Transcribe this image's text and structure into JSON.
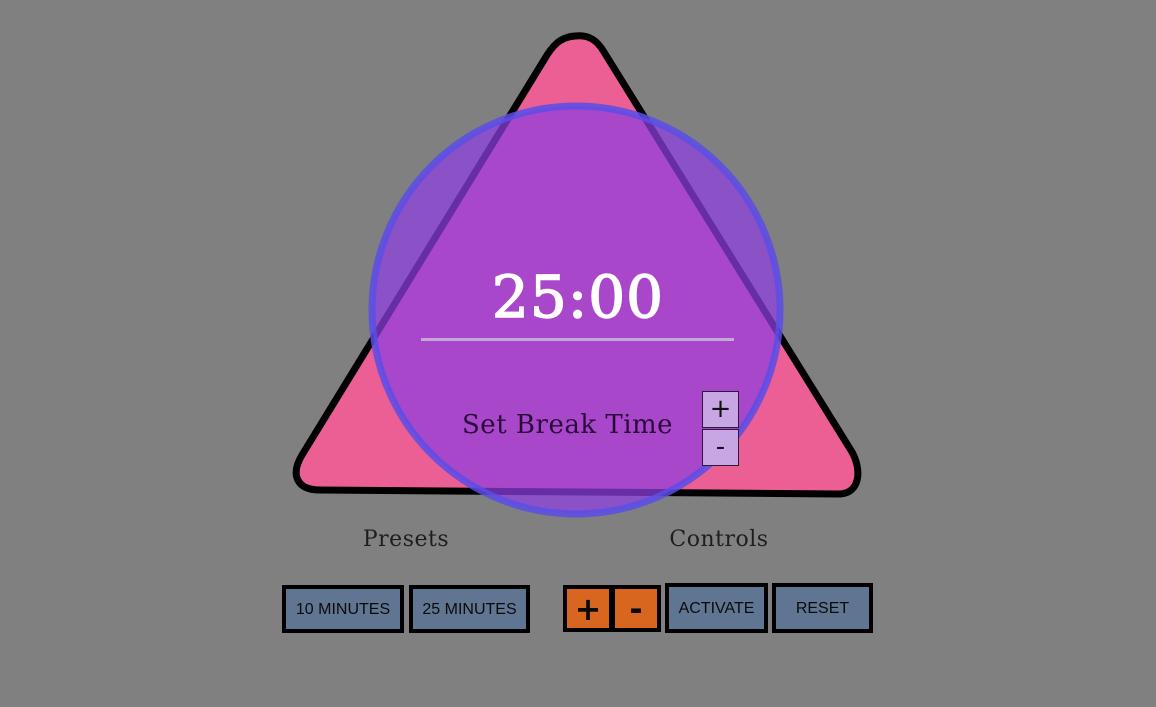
{
  "timer": {
    "display": "25:00"
  },
  "break_time": {
    "label": "Set Break Time",
    "plus_label": "+",
    "minus_label": "-"
  },
  "presets": {
    "title": "Presets",
    "buttons": [
      {
        "label": "10 MINUTES"
      },
      {
        "label": "25 MINUTES"
      }
    ]
  },
  "controls": {
    "title": "Controls",
    "plus_label": "+",
    "minus_label": "-",
    "activate_label": "ACTIVATE",
    "reset_label": "RESET"
  },
  "colors": {
    "background": "#808080",
    "triangle_fill": "#ec5f94",
    "triangle_stroke": "#000000",
    "circle_fill": "#8f3fe0",
    "circle_stroke": "#5a4ee6",
    "button_blue": "#5f7592",
    "button_orange": "#d8661f",
    "break_button": "#c7a6e3"
  }
}
